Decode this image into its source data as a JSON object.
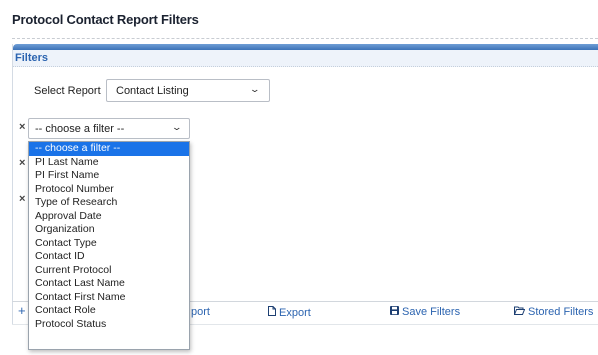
{
  "page": {
    "title": "Protocol Contact Report Filters"
  },
  "filters_panel": {
    "heading": "Filters",
    "report": {
      "label": "Select Report",
      "value": "Contact Listing"
    },
    "filter_row": {
      "remove_symbol": "×",
      "value": "-- choose a filter --"
    },
    "extra_remove_symbols": [
      "×",
      "×"
    ],
    "dropdown_options": [
      "-- choose a filter --",
      "PI Last Name",
      "PI First Name",
      "Protocol Number",
      "Type of Research",
      "Approval Date",
      "Organization",
      "Contact Type",
      "Contact ID",
      "Current Protocol",
      "Contact Last Name",
      "Contact First Name",
      "Contact Role",
      "Protocol Status"
    ],
    "selected_option_index": 0
  },
  "toolbar": {
    "add_symbol": "+",
    "report_partial": "port",
    "export_label": "Export",
    "save_filters_label": "Save Filters",
    "stored_filters_label": "Stored Filters",
    "icons": {
      "export": "file-icon",
      "save": "save-disk-icon",
      "stored": "folder-open-icon"
    }
  },
  "colors": {
    "accent": "#2c64b0",
    "selected_option": "#1a73e8",
    "header_bar": "#3c72b8"
  }
}
